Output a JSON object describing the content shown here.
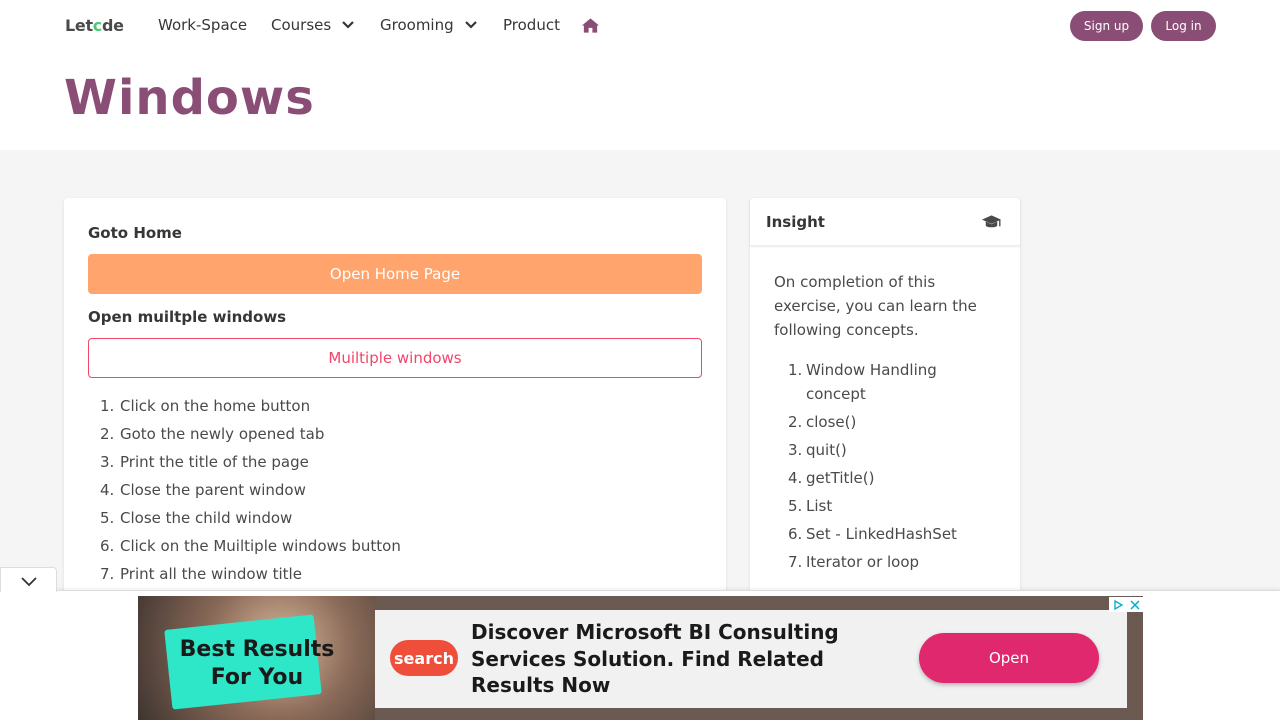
{
  "nav": {
    "logo": {
      "part1": "Let",
      "part2": "c",
      "part3": "de"
    },
    "items": [
      {
        "label": "Work-Space"
      },
      {
        "label": "Courses"
      },
      {
        "label": "Grooming"
      },
      {
        "label": "Product"
      }
    ],
    "signup_label": "Sign up",
    "login_label": "Log in",
    "colors": {
      "brand": "#8a4d76",
      "accent": "#48c774"
    }
  },
  "hero": {
    "title": "Windows"
  },
  "main": {
    "goto_home_label": "Goto Home",
    "open_home_button": "Open Home Page",
    "open_multiple_label": "Open muiltple windows",
    "multiple_windows_button": "Muiltiple windows",
    "steps": [
      {
        "num": "1.",
        "text": "Click on the home button"
      },
      {
        "num": "2.",
        "text": "Goto the newly opened tab"
      },
      {
        "num": "3.",
        "text": "Print the title of the page"
      },
      {
        "num": "4.",
        "text": "Close the parent window"
      },
      {
        "num": "5.",
        "text": "Close the child window"
      },
      {
        "num": "6.",
        "text": "Click on the Muiltiple windows button"
      },
      {
        "num": "7.",
        "text": "Print all the window title"
      }
    ],
    "colors": {
      "warning": "#ffa46d",
      "danger": "#f14668"
    }
  },
  "insight": {
    "title": "Insight",
    "intro": "On completion of this exercise, you can learn the following concepts.",
    "concepts": [
      {
        "num": "1.",
        "text": "Window Handling concept"
      },
      {
        "num": "2.",
        "text": "close()"
      },
      {
        "num": "3.",
        "text": "quit()"
      },
      {
        "num": "4.",
        "text": "getTitle()"
      },
      {
        "num": "5.",
        "text": "List"
      },
      {
        "num": "6.",
        "text": "Set - LinkedHashSet"
      },
      {
        "num": "7.",
        "text": "Iterator or loop"
      }
    ],
    "icon": "graduation-cap-icon"
  },
  "ad": {
    "tag_line1": "Best Results",
    "tag_line2": "For You",
    "logo_text": "search",
    "headline": "Discover Microsoft BI Consulting Services Solution. Find Related Results Now",
    "cta": "Open",
    "colors": {
      "cta": "#e0286f",
      "tag": "#2ee6c8",
      "logo": "#ef4f3a"
    }
  }
}
